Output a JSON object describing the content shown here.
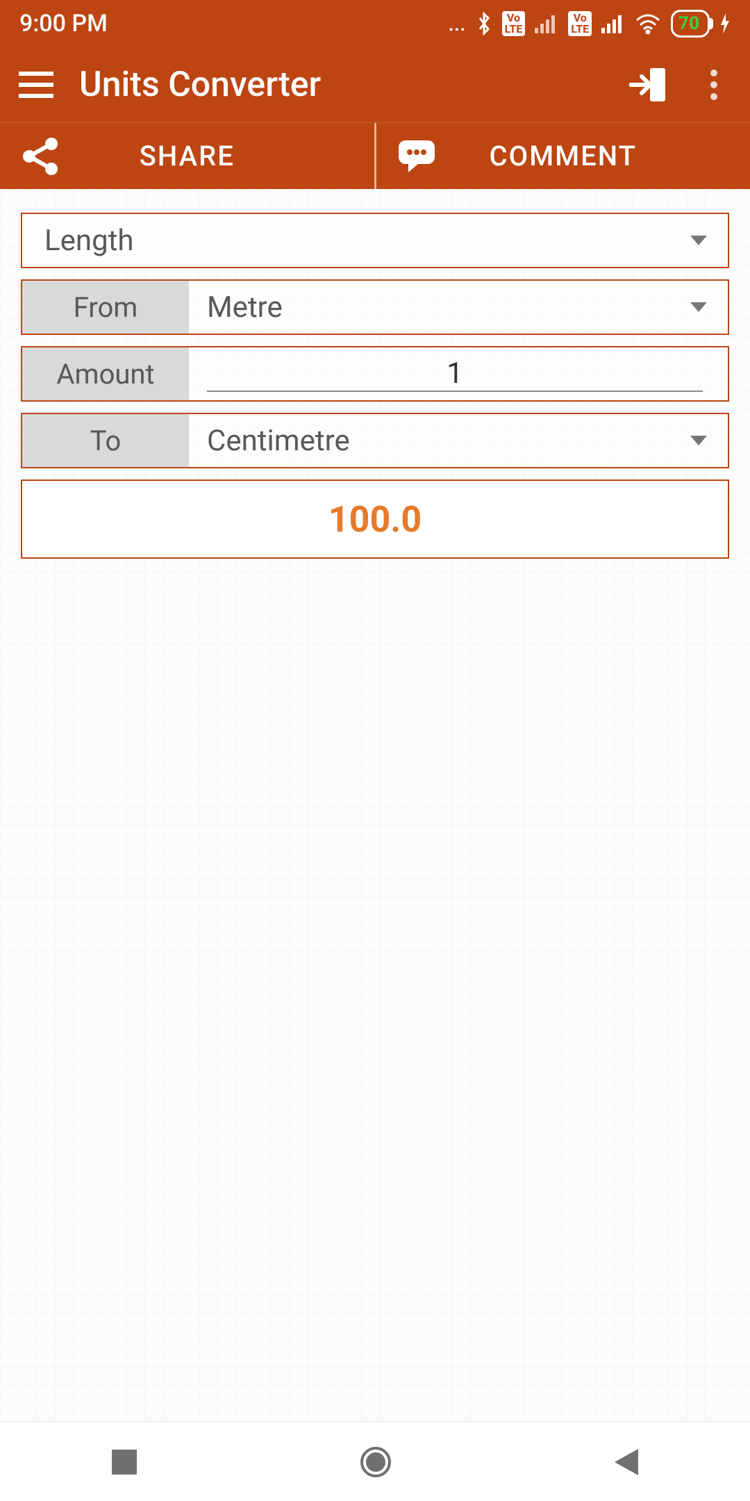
{
  "status": {
    "time": "9:00 PM",
    "battery": "70"
  },
  "header": {
    "title": "Units Converter"
  },
  "tabs": {
    "share": "SHARE",
    "comment": "COMMENT"
  },
  "form": {
    "category": "Length",
    "from_label": "From",
    "from_value": "Metre",
    "amount_label": "Amount",
    "amount_value": "1",
    "to_label": "To",
    "to_value": "Centimetre",
    "result": "100.0"
  }
}
